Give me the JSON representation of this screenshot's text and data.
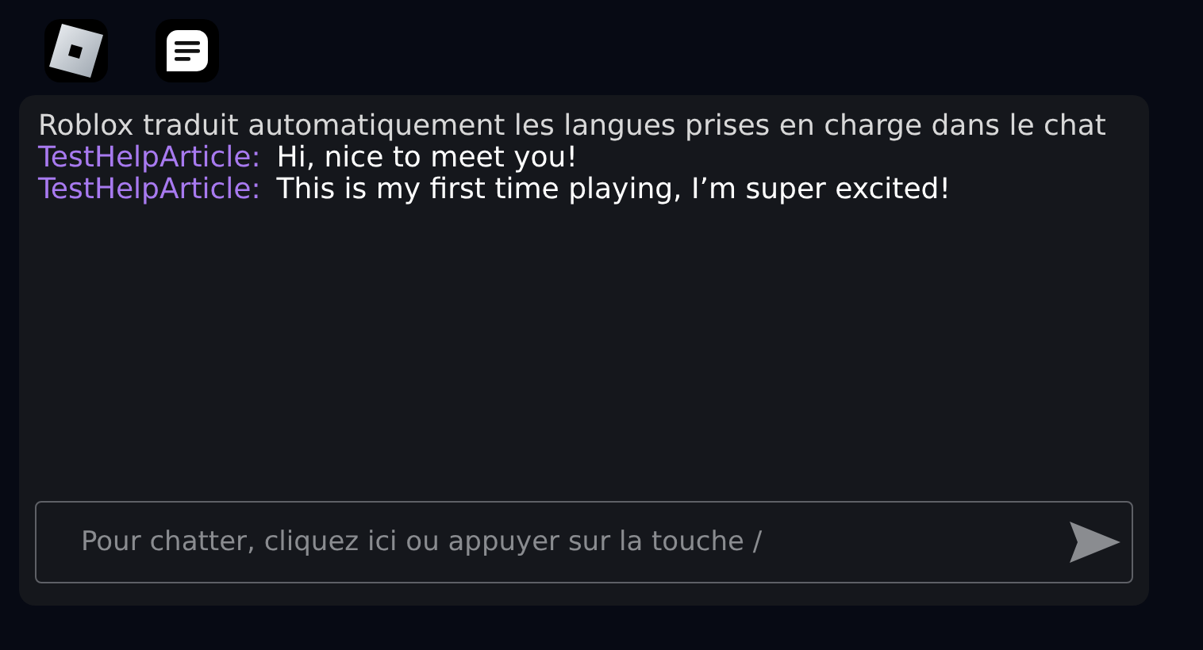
{
  "top_bar": {
    "buttons": [
      {
        "kind": "logo"
      },
      {
        "kind": "chat"
      }
    ]
  },
  "chat": {
    "messages": [
      {
        "kind": "system",
        "text": "Roblox traduit automatiquement les langues prises en charge dans le chat"
      },
      {
        "kind": "user",
        "author": "TestHelpArticle:",
        "text": "Hi, nice to meet you!"
      },
      {
        "kind": "user",
        "author": "TestHelpArticle:",
        "text": "This is my first time playing, I’m super excited!"
      }
    ],
    "input": {
      "placeholder": "Pour chatter, cliquez ici ou appuyer sur la touche /"
    }
  }
}
